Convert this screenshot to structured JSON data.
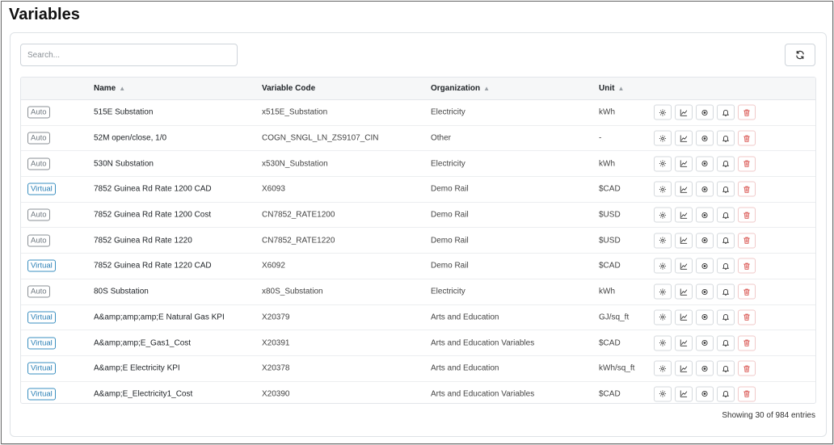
{
  "page": {
    "title": "Variables"
  },
  "search": {
    "placeholder": "Search..."
  },
  "table": {
    "headers": {
      "name": "Name",
      "code": "Variable Code",
      "organization": "Organization",
      "unit": "Unit"
    },
    "rows": [
      {
        "type": "Auto",
        "name": "515E Substation",
        "code": "x515E_Substation",
        "organization": "Electricity",
        "unit": "kWh"
      },
      {
        "type": "Auto",
        "name": "52M open/close, 1/0",
        "code": "COGN_SNGL_LN_ZS9107_CIN",
        "organization": "Other",
        "unit": "-"
      },
      {
        "type": "Auto",
        "name": "530N Substation",
        "code": "x530N_Substation",
        "organization": "Electricity",
        "unit": "kWh"
      },
      {
        "type": "Virtual",
        "name": "7852 Guinea Rd Rate 1200 CAD",
        "code": "X6093",
        "organization": "Demo Rail",
        "unit": "$CAD"
      },
      {
        "type": "Auto",
        "name": "7852 Guinea Rd Rate 1200 Cost",
        "code": "CN7852_RATE1200",
        "organization": "Demo Rail",
        "unit": "$USD"
      },
      {
        "type": "Auto",
        "name": "7852 Guinea Rd Rate 1220",
        "code": "CN7852_RATE1220",
        "organization": "Demo Rail",
        "unit": "$USD"
      },
      {
        "type": "Virtual",
        "name": "7852 Guinea Rd Rate 1220 CAD",
        "code": "X6092",
        "organization": "Demo Rail",
        "unit": "$CAD"
      },
      {
        "type": "Auto",
        "name": "80S Substation",
        "code": "x80S_Substation",
        "organization": "Electricity",
        "unit": "kWh"
      },
      {
        "type": "Virtual",
        "name": "A&amp;amp;amp;E Natural Gas KPI",
        "code": "X20379",
        "organization": "Arts and Education",
        "unit": "GJ/sq_ft"
      },
      {
        "type": "Virtual",
        "name": "A&amp;amp;E_Gas1_Cost",
        "code": "X20391",
        "organization": "Arts and Education Variables",
        "unit": "$CAD"
      },
      {
        "type": "Virtual",
        "name": "A&amp;E Electricity KPI",
        "code": "X20378",
        "organization": "Arts and Education",
        "unit": "kWh/sq_ft"
      },
      {
        "type": "Virtual",
        "name": "A&amp;E_Electricity1_Cost",
        "code": "X20390",
        "organization": "Arts and Education Variables",
        "unit": "$CAD"
      }
    ]
  },
  "footer": {
    "entries_text": "Showing 30 of 984 entries"
  },
  "icons": {
    "refresh": "refresh-icon",
    "settings": "gear-icon",
    "chart": "chart-line-icon",
    "locate": "target-icon",
    "alert": "bell-icon",
    "delete": "trash-icon",
    "sort": "sort-icon"
  },
  "colors": {
    "virtual_badge": "#2a7fb5",
    "auto_badge": "#6c757d",
    "delete": "#d9534f"
  }
}
